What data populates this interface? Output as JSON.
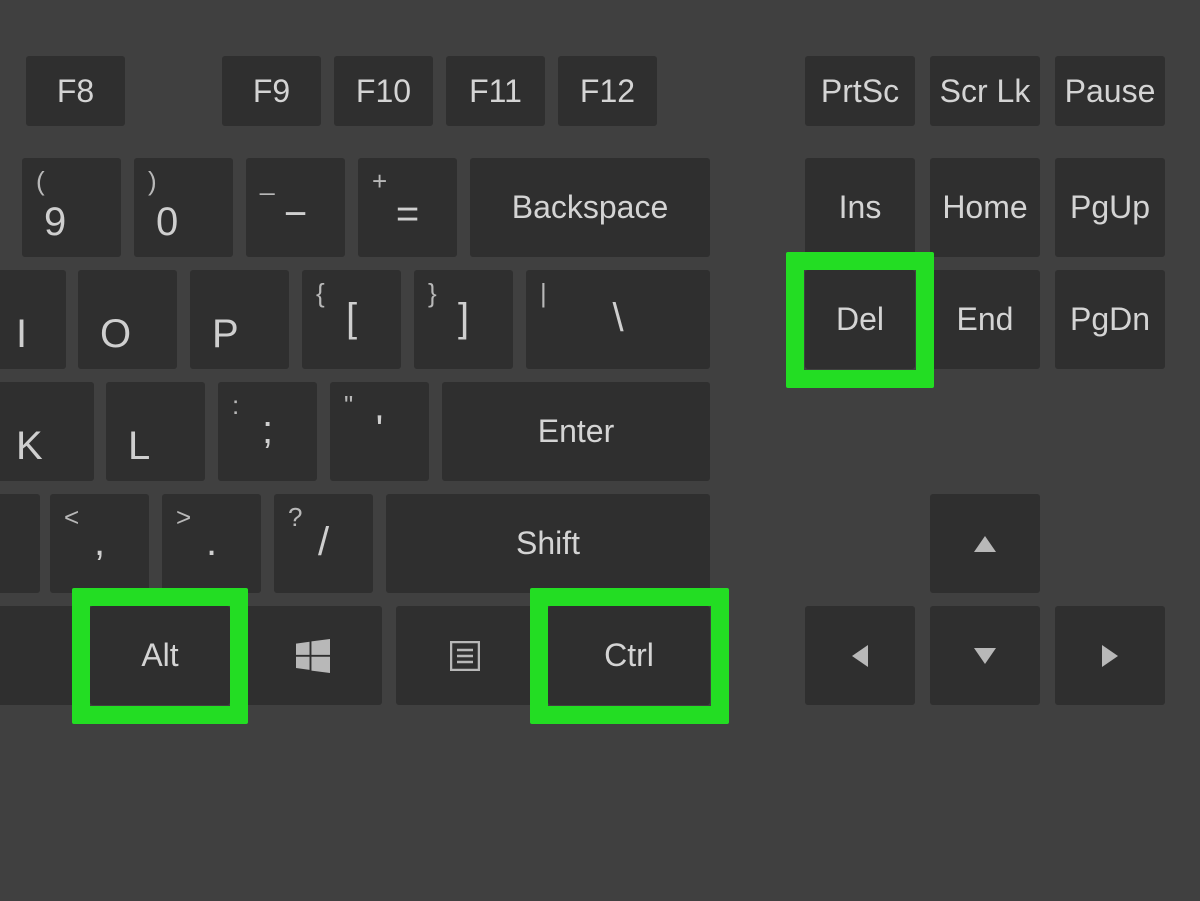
{
  "rows": {
    "fn": [
      {
        "name": "f8-key",
        "label": "F8"
      },
      {
        "name": "f9-key",
        "label": "F9"
      },
      {
        "name": "f10-key",
        "label": "F10"
      },
      {
        "name": "f11-key",
        "label": "F11"
      },
      {
        "name": "f12-key",
        "label": "F12"
      },
      {
        "name": "prtsc-key",
        "label": "PrtSc"
      },
      {
        "name": "scrlk-key",
        "label": "Scr Lk"
      },
      {
        "name": "pause-key",
        "label": "Pause"
      }
    ],
    "num": [
      {
        "name": "nine-key",
        "top": "(",
        "main": "9"
      },
      {
        "name": "zero-key",
        "top": ")",
        "main": "0"
      },
      {
        "name": "minus-key",
        "top": "_",
        "main": "−"
      },
      {
        "name": "equals-key",
        "top": "+",
        "main": "="
      },
      {
        "name": "backspace-key",
        "label": "Backspace"
      },
      {
        "name": "ins-key",
        "label": "Ins"
      },
      {
        "name": "home-key",
        "label": "Home"
      },
      {
        "name": "pgup-key",
        "label": "PgUp"
      }
    ],
    "qwerty": [
      {
        "name": "i-key",
        "main": "I"
      },
      {
        "name": "o-key",
        "main": "O"
      },
      {
        "name": "p-key",
        "main": "P"
      },
      {
        "name": "lbracket-key",
        "top": "{",
        "main": "["
      },
      {
        "name": "rbracket-key",
        "top": "}",
        "main": "]"
      },
      {
        "name": "backslash-key",
        "top": "|",
        "main": "\\"
      },
      {
        "name": "del-key",
        "label": "Del",
        "highlight": true
      },
      {
        "name": "end-key",
        "label": "End"
      },
      {
        "name": "pgdn-key",
        "label": "PgDn"
      }
    ],
    "home": [
      {
        "name": "k-key",
        "main": "K"
      },
      {
        "name": "l-key",
        "main": "L"
      },
      {
        "name": "semicolon-key",
        "top": ":",
        "main": ";"
      },
      {
        "name": "quote-key",
        "top": "\"",
        "main": "'"
      },
      {
        "name": "enter-key",
        "label": "Enter"
      }
    ],
    "shiftRow": [
      {
        "name": "comma-key",
        "top": "<",
        "main": ","
      },
      {
        "name": "period-key",
        "top": ">",
        "main": "."
      },
      {
        "name": "slash-key",
        "top": "?",
        "main": "/"
      },
      {
        "name": "shift-key",
        "label": "Shift"
      },
      {
        "name": "arrow-up-key",
        "icon": "up"
      }
    ],
    "bottom": [
      {
        "name": "alt-key",
        "label": "Alt",
        "highlight": true
      },
      {
        "name": "win-key",
        "icon": "win"
      },
      {
        "name": "menu-key",
        "icon": "menu"
      },
      {
        "name": "ctrl-key",
        "label": "Ctrl",
        "highlight": true
      },
      {
        "name": "arrow-left-key",
        "icon": "left"
      },
      {
        "name": "arrow-down-key",
        "icon": "down"
      },
      {
        "name": "arrow-right-key",
        "icon": "right"
      }
    ]
  },
  "highlight_color": "#23dd23"
}
